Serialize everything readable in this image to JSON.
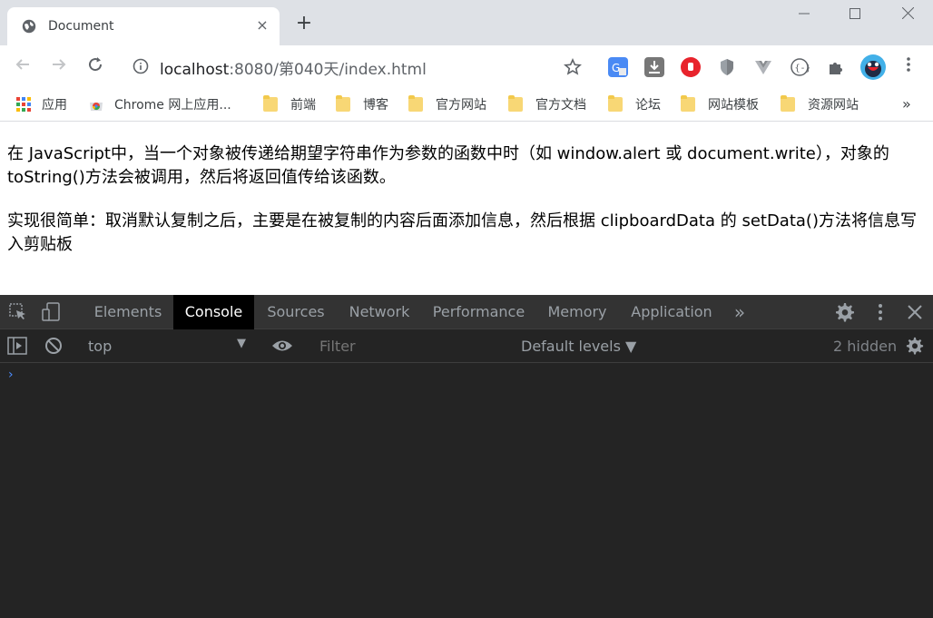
{
  "browser": {
    "tab_title": "Document",
    "tab_close": "×",
    "new_tab": "+",
    "window_controls": {
      "minimize": "—",
      "maximize": "☐",
      "close": "✕"
    },
    "url_host": "localhost",
    "url_rest": ":8080/第040天/index.html",
    "bookmarks": [
      {
        "label": "应用",
        "icon": "apps-icon"
      },
      {
        "label": "Chrome 网上应用...",
        "icon": "chrome-store-icon"
      },
      {
        "label": "前端",
        "icon": "folder-icon"
      },
      {
        "label": "博客",
        "icon": "folder-icon"
      },
      {
        "label": "官方网站",
        "icon": "folder-icon"
      },
      {
        "label": "官方文档",
        "icon": "folder-icon"
      },
      {
        "label": "论坛",
        "icon": "folder-icon"
      },
      {
        "label": "网站模板",
        "icon": "folder-icon"
      },
      {
        "label": "资源网站",
        "icon": "folder-icon"
      }
    ],
    "bookmarks_more": "»"
  },
  "page": {
    "paragraph1": "在 JavaScript中，当一个对象被传递给期望字符串作为参数的函数中时（如 window.alert 或 document.write），对象的toString()方法会被调用，然后将返回值传给该函数。",
    "paragraph2": "实现很简单：取消默认复制之后，主要是在被复制的内容后面添加信息，然后根据 clipboardData 的 setData()方法将信息写入剪贴板"
  },
  "devtools": {
    "tabs": [
      "Elements",
      "Console",
      "Sources",
      "Network",
      "Performance",
      "Memory",
      "Application"
    ],
    "active_tab": "Console",
    "more_tabs": "»",
    "context": "top",
    "filter_placeholder": "Filter",
    "levels": "Default levels ▼",
    "hidden_count": "2 hidden",
    "prompt": "›"
  },
  "colors": {
    "accent": "#4c8dff",
    "devtools_bg": "#242424",
    "tabstrip_bg": "#dee1e6"
  }
}
